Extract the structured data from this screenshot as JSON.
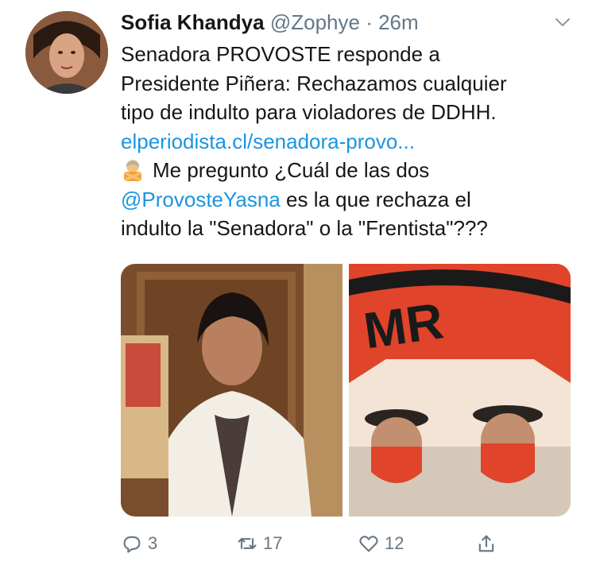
{
  "tweet": {
    "author_name": "Sofia Khandya",
    "handle": "@Zophye",
    "separator": "·",
    "time": "26m",
    "line1": "Senadora PROVOSTE responde a",
    "line2": "Presidente Piñera: Rechazamos cualquier",
    "line3": "tipo de indulto para violadores de DDHH.",
    "link": "elperiodista.cl/senadora-provo...",
    "line5": "Me pregunto ¿Cuál de las dos",
    "mention": "@ProvosteYasna",
    "line6_rest": " es la que rechaza el",
    "line7": "indulto la \"Senadora\" o la \"Frentista\"???",
    "emoji": "person-gesturing-no-emoji",
    "image_right_text": "MR"
  },
  "actions": {
    "reply_count": "3",
    "retweet_count": "17",
    "like_count": "12"
  },
  "colors": {
    "link": "#1b95e0",
    "secondary": "#657786",
    "text": "#14171a",
    "fpmr_red": "#e0442a"
  }
}
